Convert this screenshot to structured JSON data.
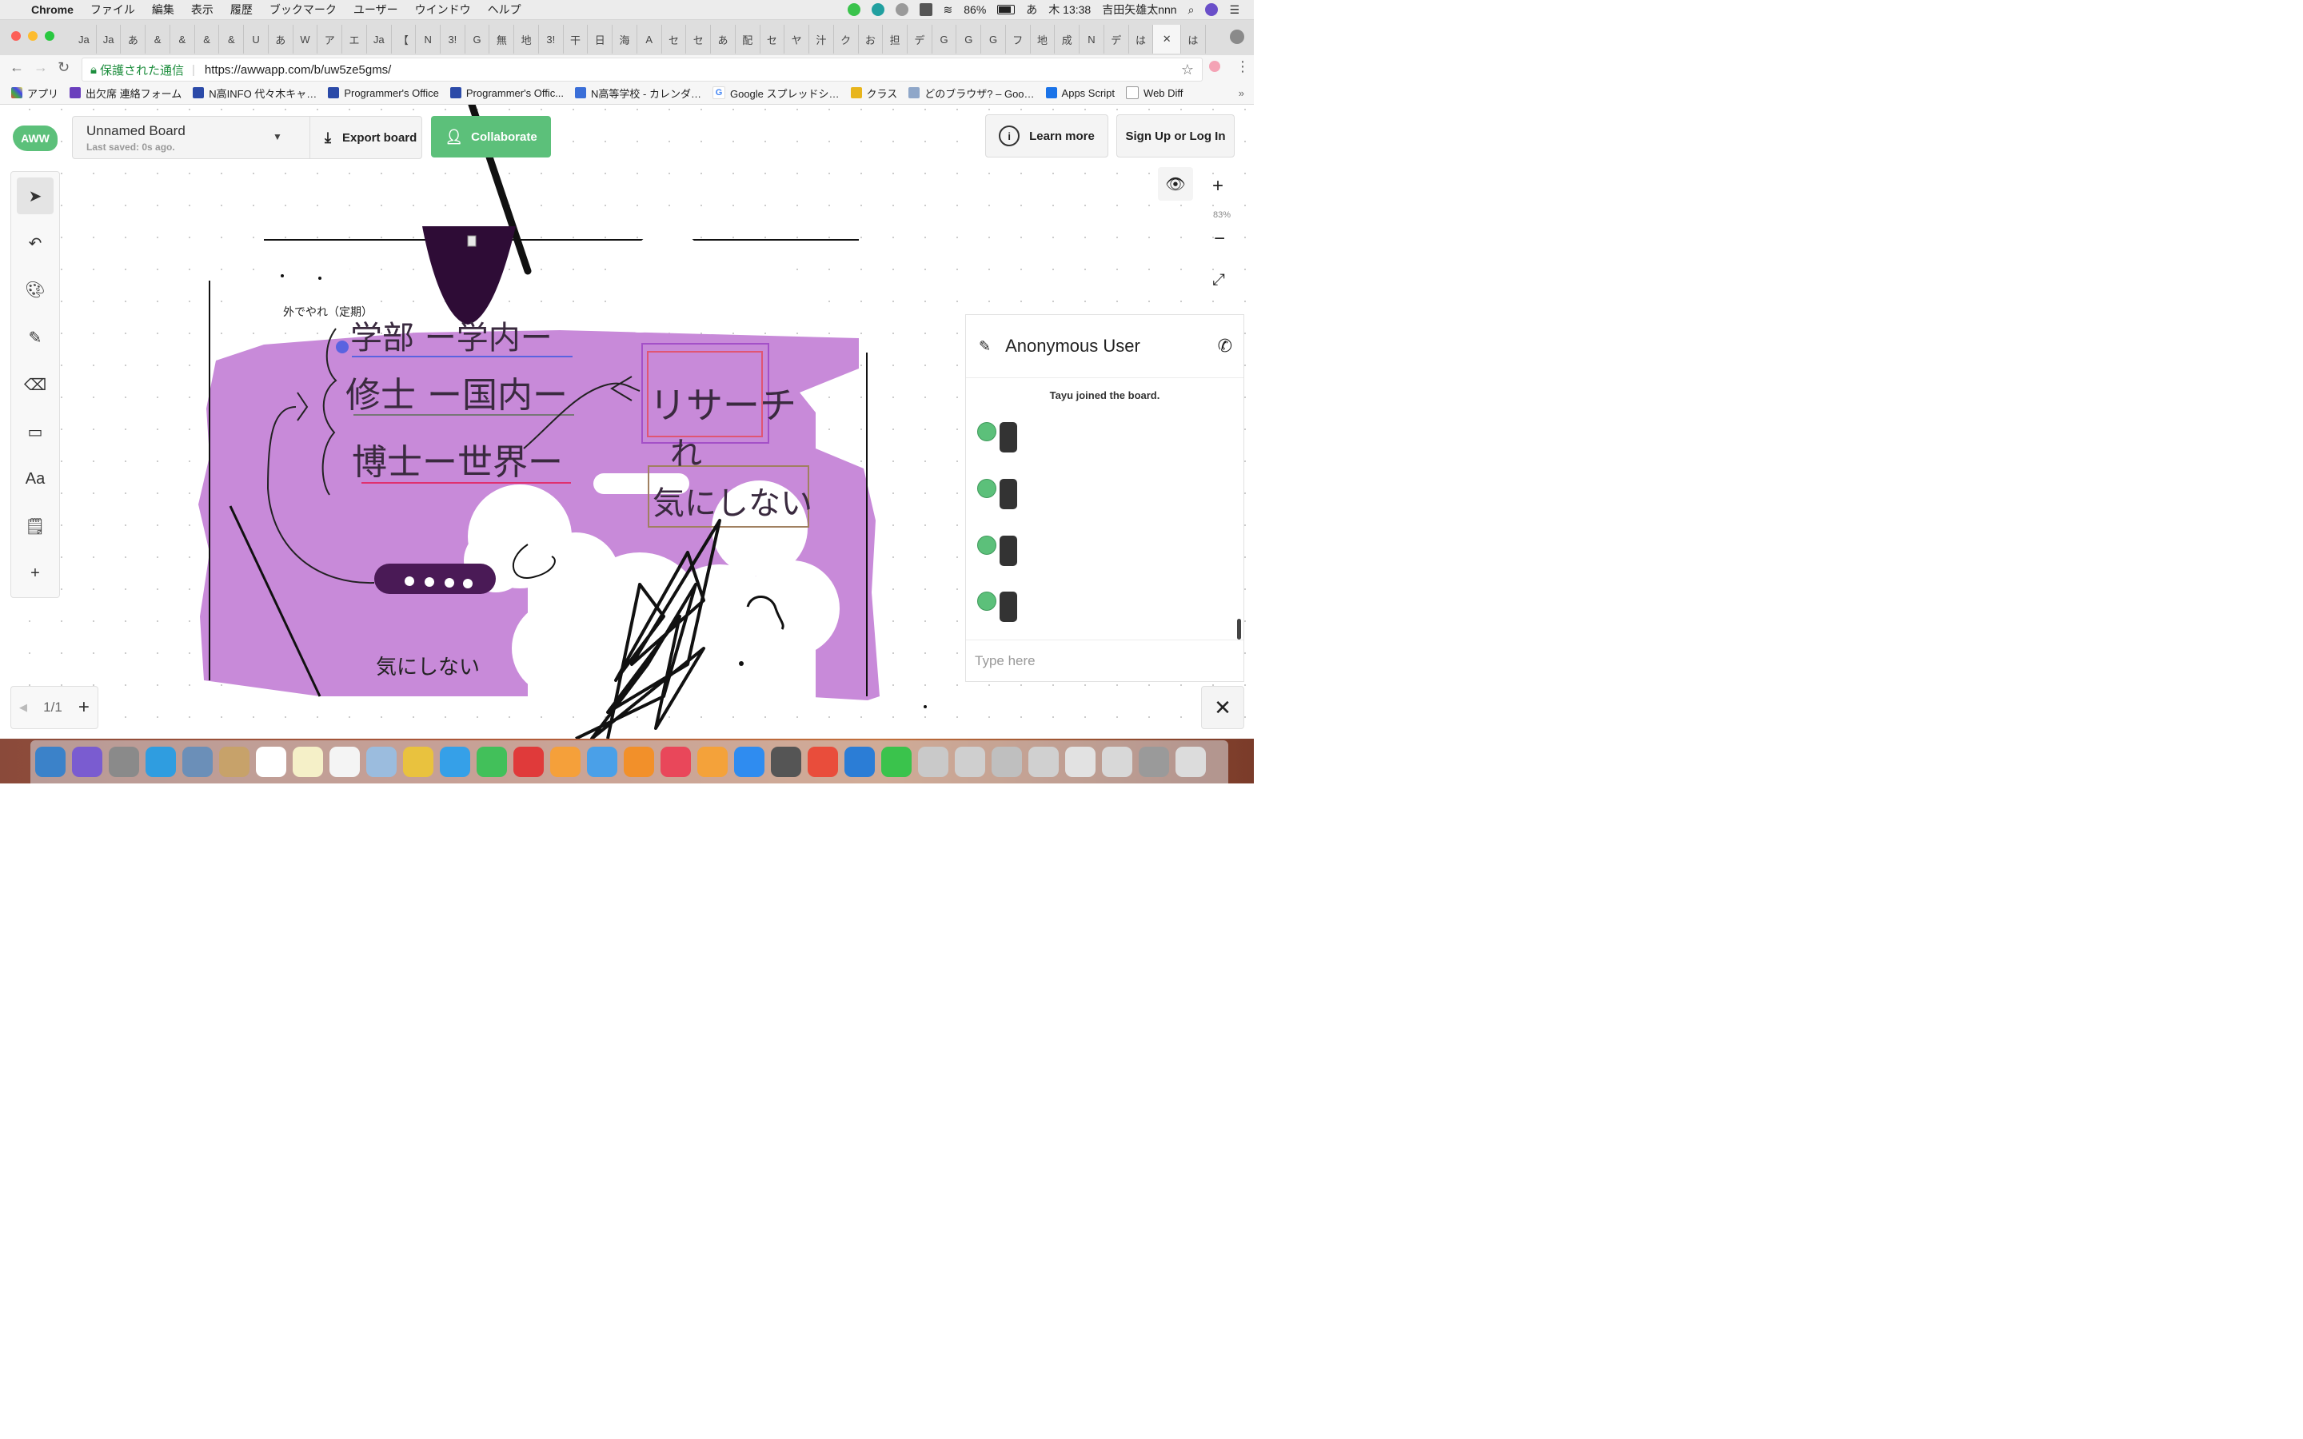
{
  "menubar": {
    "app": "Chrome",
    "items": [
      "ファイル",
      "編集",
      "表示",
      "履歴",
      "ブックマーク",
      "ユーザー",
      "ウインドウ",
      "ヘルプ"
    ],
    "battery": "86%",
    "ime": "あ",
    "clock": "木 13:38",
    "user": "吉田矢雄太nnn"
  },
  "tabs": [
    "Ja",
    "Ja",
    "あ",
    "&",
    "&",
    "&",
    "&",
    "U",
    "あ",
    "W",
    "ア",
    "エ",
    "Ja",
    "【",
    "N",
    "3!",
    "G",
    "無",
    "地",
    "3!",
    "干",
    "日",
    "海",
    "A",
    "セ",
    "セ",
    "あ",
    "配",
    "セ",
    "ヤ",
    "汁",
    "ク",
    "お",
    "担",
    "デ",
    "G",
    "G",
    "G",
    "フ",
    "地",
    "成",
    "N",
    "デ",
    "は",
    "",
    "は"
  ],
  "address": {
    "secure": "保護された通信",
    "url": "https://awwapp.com/b/uw5ze5gms/"
  },
  "bookmarks": [
    "アプリ",
    "出欠席 連絡フォーム",
    "N高INFO 代々木キャ…",
    "Programmer's Office",
    "Programmer's Offic...",
    "N高等学校 - カレンダ…",
    "Google スプレッドシ…",
    "クラス",
    "どのブラウザ? – Goo…",
    "Apps Script",
    "Web Diff"
  ],
  "app": {
    "logo": "AWW",
    "board_name": "Unnamed Board",
    "last_saved": "Last saved: 0s ago.",
    "export": "Export board",
    "collaborate": "Collaborate",
    "learn_more": "Learn more",
    "signup": "Sign Up or Log In",
    "zoom": "83%",
    "page": "1/1",
    "text_tool": "Aa"
  },
  "chat": {
    "user": "Anonymous User",
    "joined": "Tayu joined the board.",
    "placeholder": "Type here"
  },
  "drawing": {
    "label_small": "外でやれ（定期）",
    "label_bottom": "気にしない",
    "hw1": "学部 ー学内ー",
    "hw2": "修士 ー国内ー",
    "hw3": "博士ー世界ー",
    "hw4": "リサーチ",
    "hw5": "れ",
    "hw6": "気にしない"
  }
}
